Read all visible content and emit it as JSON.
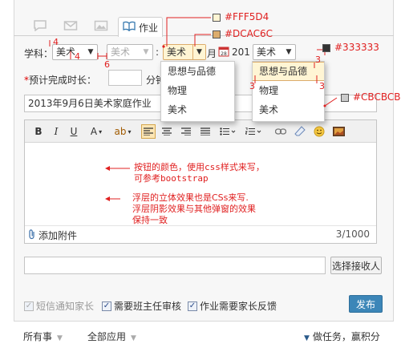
{
  "tabs": {
    "active_label": "作业"
  },
  "form": {
    "subject_label": "学科：",
    "subject_select": "美术",
    "subject_select2": "美术",
    "estimate_label": "预计完成时长：",
    "minutes_unit": "分钟",
    "month_partial": "月",
    "year_partial": "201",
    "select3": "美术",
    "select4": "美术",
    "title_value": "2013年9月6日美术家庭作业"
  },
  "popup1": {
    "items": [
      "思想与品德",
      "物理",
      "美术"
    ]
  },
  "popup2": {
    "items": [
      "思想与品德",
      "物理",
      "美术"
    ]
  },
  "editor": {
    "attach_label": "添加附件",
    "char_count": "3/1000",
    "note1": [
      "按钮的颜色，使用css样式来写，",
      "可参考bootstrap"
    ],
    "note2": [
      "浮层的立体效果也是CSs来写.",
      "浮层阴影效果与其他弹窗的效果",
      "保持一致"
    ]
  },
  "recipient": {
    "button_label": "选择接收人"
  },
  "checks": [
    {
      "label": "短信通知家长",
      "checked": true,
      "disabled": true
    },
    {
      "label": "需要班主任审核",
      "checked": true,
      "disabled": false
    },
    {
      "label": "作业需要家长反馈",
      "checked": true,
      "disabled": false
    }
  ],
  "publish_label": "发布",
  "footer": {
    "filter1": "所有事",
    "filter2": "全部应用",
    "right_text": "做任务，赢积分"
  },
  "annotations": {
    "color1": "#FFF5D4",
    "color2": "#DCAC6C",
    "color3": "#333333",
    "color4": "#CBCBCB",
    "n4a": "4",
    "n4b": "4",
    "n6": "6",
    "n3a": "3",
    "n3b": "3",
    "n3c": "3"
  },
  "colors": {
    "highlight_bg": "#FFF5D4",
    "highlight_border": "#DCAC6C",
    "text": "#333333",
    "popup_border": "#CBCBCB",
    "publish_blue": "#3C86B8",
    "annotation_red": "#E02020"
  }
}
